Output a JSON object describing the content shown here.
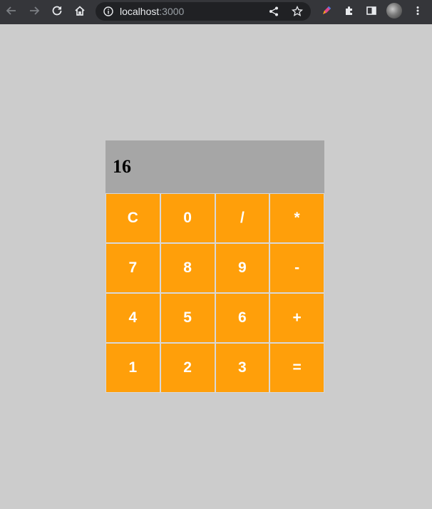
{
  "browser": {
    "url_host": "localhost",
    "url_port": ":3000",
    "icons": [
      "back-icon",
      "forward-icon",
      "reload-icon",
      "home-icon",
      "info-icon",
      "share-icon",
      "bookmark-star-icon",
      "extension-pen-icon",
      "puzzle-icon",
      "side-panel-icon",
      "profile-avatar",
      "more-menu-icon"
    ]
  },
  "calculator": {
    "display_value": "16",
    "keys": [
      {
        "label": "C",
        "name": "clear-button"
      },
      {
        "label": "0",
        "name": "digit-0-button"
      },
      {
        "label": "/",
        "name": "divide-button"
      },
      {
        "label": "*",
        "name": "multiply-button"
      },
      {
        "label": "7",
        "name": "digit-7-button"
      },
      {
        "label": "8",
        "name": "digit-8-button"
      },
      {
        "label": "9",
        "name": "digit-9-button"
      },
      {
        "label": "-",
        "name": "subtract-button"
      },
      {
        "label": "4",
        "name": "digit-4-button"
      },
      {
        "label": "5",
        "name": "digit-5-button"
      },
      {
        "label": "6",
        "name": "digit-6-button"
      },
      {
        "label": "+",
        "name": "add-button"
      },
      {
        "label": "1",
        "name": "digit-1-button"
      },
      {
        "label": "2",
        "name": "digit-2-button"
      },
      {
        "label": "3",
        "name": "digit-3-button"
      },
      {
        "label": "=",
        "name": "equals-button"
      }
    ]
  },
  "colors": {
    "page_background": "#cccccc",
    "display_background": "#a6a6a6",
    "key_background": "#ff9f0a",
    "key_text": "#ffffff",
    "browser_bar": "#35363a"
  }
}
